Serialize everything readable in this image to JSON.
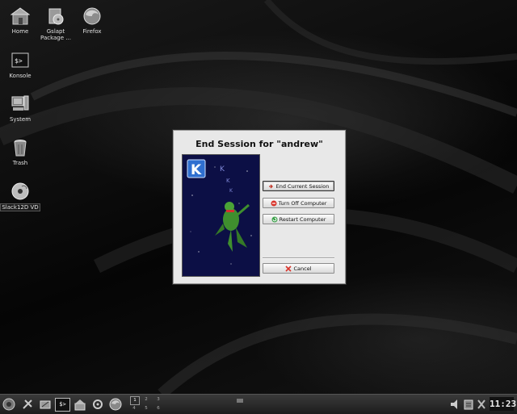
{
  "desktop": {
    "icons": [
      {
        "label": "Home",
        "icon": "home-folder-icon"
      },
      {
        "label": "Gslapt Package ...",
        "icon": "package-manager-icon"
      },
      {
        "label": "Firefox",
        "icon": "firefox-icon"
      },
      {
        "label": "Konsole",
        "icon": "terminal-icon"
      },
      {
        "label": "System",
        "icon": "computer-icon"
      },
      {
        "label": "Trash",
        "icon": "trash-icon"
      },
      {
        "label": "Slack12D VD",
        "icon": "dvd-drive-icon"
      }
    ]
  },
  "dialog": {
    "title": "End Session for \"andrew\"",
    "buttons": {
      "end_session": "End Current Session",
      "turn_off": "Turn Off Computer",
      "restart": "Restart Computer",
      "cancel": "Cancel"
    },
    "illustration_letter": "K"
  },
  "taskbar": {
    "pager": [
      "1",
      "2",
      "3",
      "4",
      "5",
      "6"
    ],
    "active_desktop": "1",
    "clock": "11:23",
    "konsole_glyph": "$>"
  },
  "colors": {
    "dialog_bg": "#e8e8e8",
    "illustration_bg": "#0c0f45",
    "moon": "#f2e27a",
    "dragon": "#3f8f2e",
    "kde_blue": "#2f6fd0"
  }
}
